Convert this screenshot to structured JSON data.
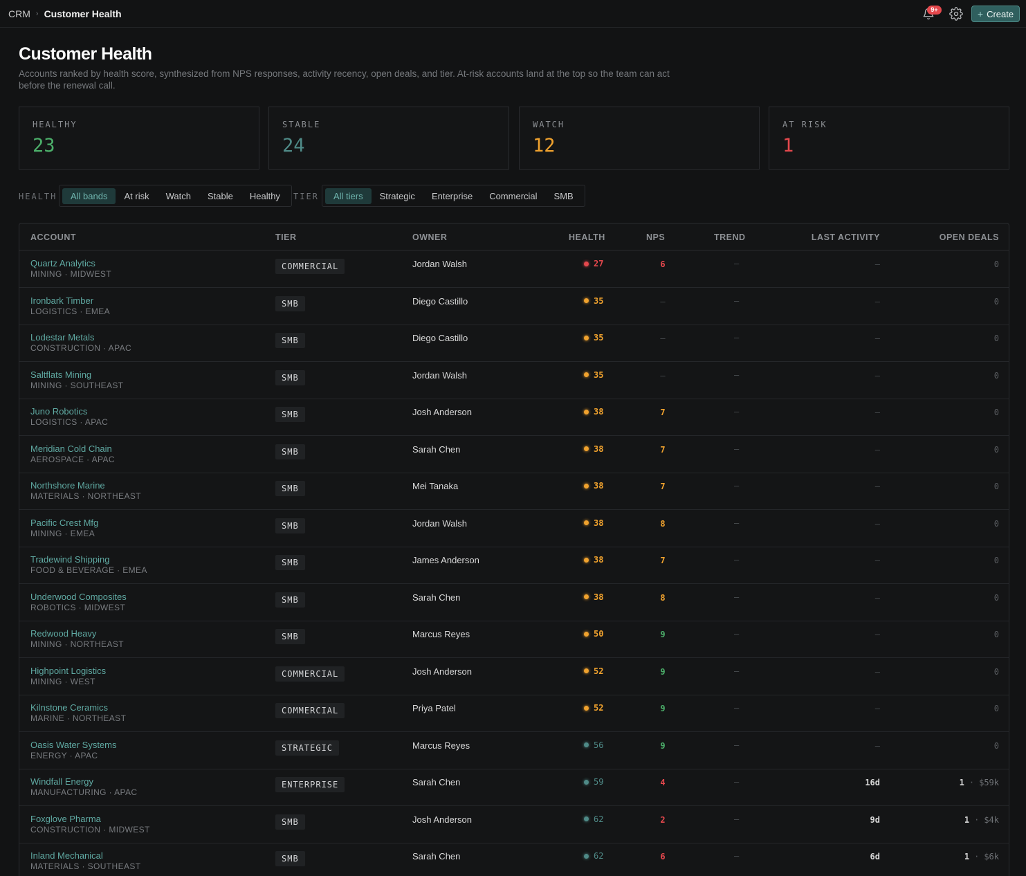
{
  "breadcrumb": {
    "root": "CRM",
    "separator": "›",
    "current": "Customer Health"
  },
  "header": {
    "notification_badge": "9+",
    "create_label": "Create",
    "create_icon": "+"
  },
  "page": {
    "title": "Customer Health",
    "subtitle": "Accounts ranked by health score, synthesized from NPS responses, activity recency, open deals, and tier. At-risk accounts land at the top so the team can act before the renewal call."
  },
  "stats": [
    {
      "label": "HEALTHY",
      "value": "23",
      "color": "#4caf6a"
    },
    {
      "label": "STABLE",
      "value": "24",
      "color": "#4f8a87"
    },
    {
      "label": "WATCH",
      "value": "12",
      "color": "#f0a22e"
    },
    {
      "label": "AT RISK",
      "value": "1",
      "color": "#e5484d"
    }
  ],
  "filters": {
    "health_label": "HEALTH",
    "health_options": [
      "All bands",
      "At risk",
      "Watch",
      "Stable",
      "Healthy"
    ],
    "health_selected": "All bands",
    "tier_label": "TIER",
    "tier_options": [
      "All tiers",
      "Strategic",
      "Enterprise",
      "Commercial",
      "SMB"
    ],
    "tier_selected": "All tiers"
  },
  "table": {
    "columns": [
      "ACCOUNT",
      "TIER",
      "OWNER",
      "HEALTH",
      "NPS",
      "TREND",
      "LAST ACTIVITY",
      "OPEN DEALS"
    ],
    "band_colors": {
      "risk": "#e5484d",
      "watch": "#f0a22e",
      "stable": "#4f8a87",
      "healthy": "#4caf6a"
    },
    "nps_colors": {
      "low": "#e5484d",
      "mid": "#f0a22e",
      "high": "#4caf6a",
      "none": "#4a4d51"
    },
    "rows": [
      {
        "name": "Quartz Analytics",
        "meta": "MINING · MIDWEST",
        "tier": "COMMERCIAL",
        "owner": "Jordan Walsh",
        "health": "27",
        "band": "risk",
        "nps": "6",
        "nps_level": "low",
        "trend": "—",
        "activity": "—",
        "deals": "0",
        "deal_amount": ""
      },
      {
        "name": "Ironbark Timber",
        "meta": "LOGISTICS · EMEA",
        "tier": "SMB",
        "owner": "Diego Castillo",
        "health": "35",
        "band": "watch",
        "nps": "—",
        "nps_level": "none",
        "trend": "—",
        "activity": "—",
        "deals": "0",
        "deal_amount": ""
      },
      {
        "name": "Lodestar Metals",
        "meta": "CONSTRUCTION · APAC",
        "tier": "SMB",
        "owner": "Diego Castillo",
        "health": "35",
        "band": "watch",
        "nps": "—",
        "nps_level": "none",
        "trend": "—",
        "activity": "—",
        "deals": "0",
        "deal_amount": ""
      },
      {
        "name": "Saltflats Mining",
        "meta": "MINING · SOUTHEAST",
        "tier": "SMB",
        "owner": "Jordan Walsh",
        "health": "35",
        "band": "watch",
        "nps": "—",
        "nps_level": "none",
        "trend": "—",
        "activity": "—",
        "deals": "0",
        "deal_amount": ""
      },
      {
        "name": "Juno Robotics",
        "meta": "LOGISTICS · APAC",
        "tier": "SMB",
        "owner": "Josh Anderson",
        "health": "38",
        "band": "watch",
        "nps": "7",
        "nps_level": "mid",
        "trend": "—",
        "activity": "—",
        "deals": "0",
        "deal_amount": ""
      },
      {
        "name": "Meridian Cold Chain",
        "meta": "AEROSPACE · APAC",
        "tier": "SMB",
        "owner": "Sarah Chen",
        "health": "38",
        "band": "watch",
        "nps": "7",
        "nps_level": "mid",
        "trend": "—",
        "activity": "—",
        "deals": "0",
        "deal_amount": ""
      },
      {
        "name": "Northshore Marine",
        "meta": "MATERIALS · NORTHEAST",
        "tier": "SMB",
        "owner": "Mei Tanaka",
        "health": "38",
        "band": "watch",
        "nps": "7",
        "nps_level": "mid",
        "trend": "—",
        "activity": "—",
        "deals": "0",
        "deal_amount": ""
      },
      {
        "name": "Pacific Crest Mfg",
        "meta": "MINING · EMEA",
        "tier": "SMB",
        "owner": "Jordan Walsh",
        "health": "38",
        "band": "watch",
        "nps": "8",
        "nps_level": "mid",
        "trend": "—",
        "activity": "—",
        "deals": "0",
        "deal_amount": ""
      },
      {
        "name": "Tradewind Shipping",
        "meta": "FOOD & BEVERAGE · EMEA",
        "tier": "SMB",
        "owner": "James Anderson",
        "health": "38",
        "band": "watch",
        "nps": "7",
        "nps_level": "mid",
        "trend": "—",
        "activity": "—",
        "deals": "0",
        "deal_amount": ""
      },
      {
        "name": "Underwood Composites",
        "meta": "ROBOTICS · MIDWEST",
        "tier": "SMB",
        "owner": "Sarah Chen",
        "health": "38",
        "band": "watch",
        "nps": "8",
        "nps_level": "mid",
        "trend": "—",
        "activity": "—",
        "deals": "0",
        "deal_amount": ""
      },
      {
        "name": "Redwood Heavy",
        "meta": "MINING · NORTHEAST",
        "tier": "SMB",
        "owner": "Marcus Reyes",
        "health": "50",
        "band": "watch",
        "nps": "9",
        "nps_level": "high",
        "trend": "—",
        "activity": "—",
        "deals": "0",
        "deal_amount": ""
      },
      {
        "name": "Highpoint Logistics",
        "meta": "MINING · WEST",
        "tier": "COMMERCIAL",
        "owner": "Josh Anderson",
        "health": "52",
        "band": "watch",
        "nps": "9",
        "nps_level": "high",
        "trend": "—",
        "activity": "—",
        "deals": "0",
        "deal_amount": ""
      },
      {
        "name": "Kilnstone Ceramics",
        "meta": "MARINE · NORTHEAST",
        "tier": "COMMERCIAL",
        "owner": "Priya Patel",
        "health": "52",
        "band": "watch",
        "nps": "9",
        "nps_level": "high",
        "trend": "—",
        "activity": "—",
        "deals": "0",
        "deal_amount": ""
      },
      {
        "name": "Oasis Water Systems",
        "meta": "ENERGY · APAC",
        "tier": "STRATEGIC",
        "owner": "Marcus Reyes",
        "health": "56",
        "band": "stable",
        "nps": "9",
        "nps_level": "high",
        "trend": "—",
        "activity": "—",
        "deals": "0",
        "deal_amount": ""
      },
      {
        "name": "Windfall Energy",
        "meta": "MANUFACTURING · APAC",
        "tier": "ENTERPRISE",
        "owner": "Sarah Chen",
        "health": "59",
        "band": "stable",
        "nps": "4",
        "nps_level": "low",
        "trend": "—",
        "activity": "16d",
        "deals": "1",
        "deal_amount": "$59k"
      },
      {
        "name": "Foxglove Pharma",
        "meta": "CONSTRUCTION · MIDWEST",
        "tier": "SMB",
        "owner": "Josh Anderson",
        "health": "62",
        "band": "stable",
        "nps": "2",
        "nps_level": "low",
        "trend": "—",
        "activity": "9d",
        "deals": "1",
        "deal_amount": "$4k"
      },
      {
        "name": "Inland Mechanical",
        "meta": "MATERIALS · SOUTHEAST",
        "tier": "SMB",
        "owner": "Sarah Chen",
        "health": "62",
        "band": "stable",
        "nps": "6",
        "nps_level": "low",
        "trend": "—",
        "activity": "6d",
        "deals": "1",
        "deal_amount": "$6k"
      }
    ]
  }
}
